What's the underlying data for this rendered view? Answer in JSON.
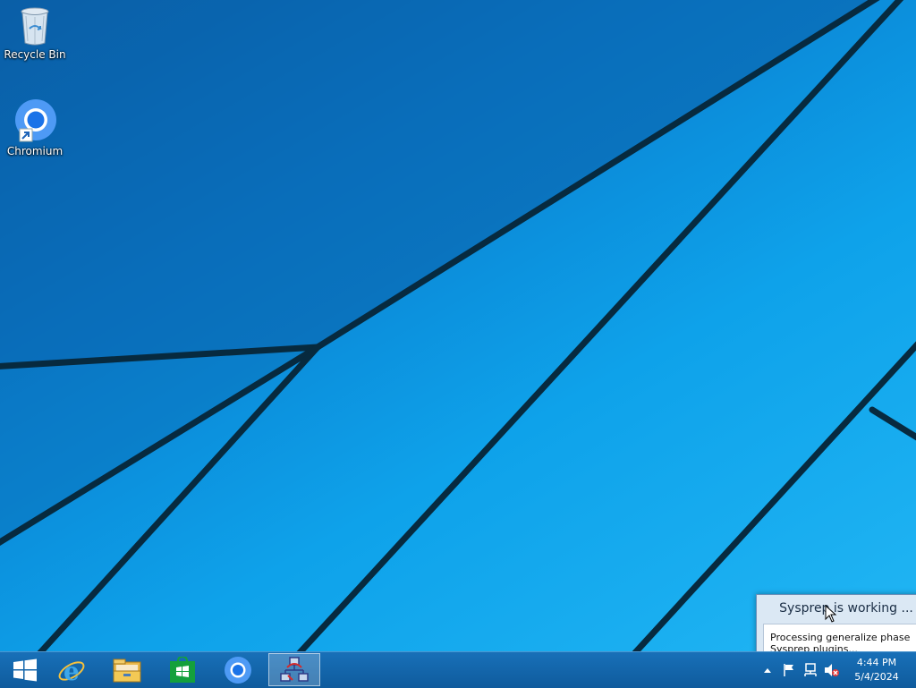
{
  "desktop": {
    "icons": [
      {
        "label": "Recycle Bin",
        "icon": "recycle-bin-icon"
      },
      {
        "label": "Chromium",
        "icon": "chromium-icon"
      }
    ]
  },
  "sysprep_window": {
    "title": "Sysprep is working ...",
    "status": "Processing generalize phase Sysprep plugins..."
  },
  "taskbar": {
    "buttons": [
      {
        "name": "start",
        "icon": "windows-logo-icon"
      },
      {
        "name": "internet-explorer",
        "icon": "internet-explorer-icon"
      },
      {
        "name": "file-explorer",
        "icon": "file-explorer-icon"
      },
      {
        "name": "store",
        "icon": "store-icon"
      },
      {
        "name": "chromium",
        "icon": "chromium-icon"
      },
      {
        "name": "sysprep",
        "icon": "sysprep-network-icon",
        "active": true
      }
    ],
    "tray": {
      "icons": [
        "show-hidden-icons-chevron",
        "action-center-flag-icon",
        "network-icon",
        "volume-muted-icon"
      ],
      "time": "4:44 PM",
      "date": "5/4/2024"
    }
  },
  "colors": {
    "taskbar": "#0f5b9d",
    "desktop_dark": "#0c5fa6",
    "desktop_light": "#21b6f4"
  }
}
